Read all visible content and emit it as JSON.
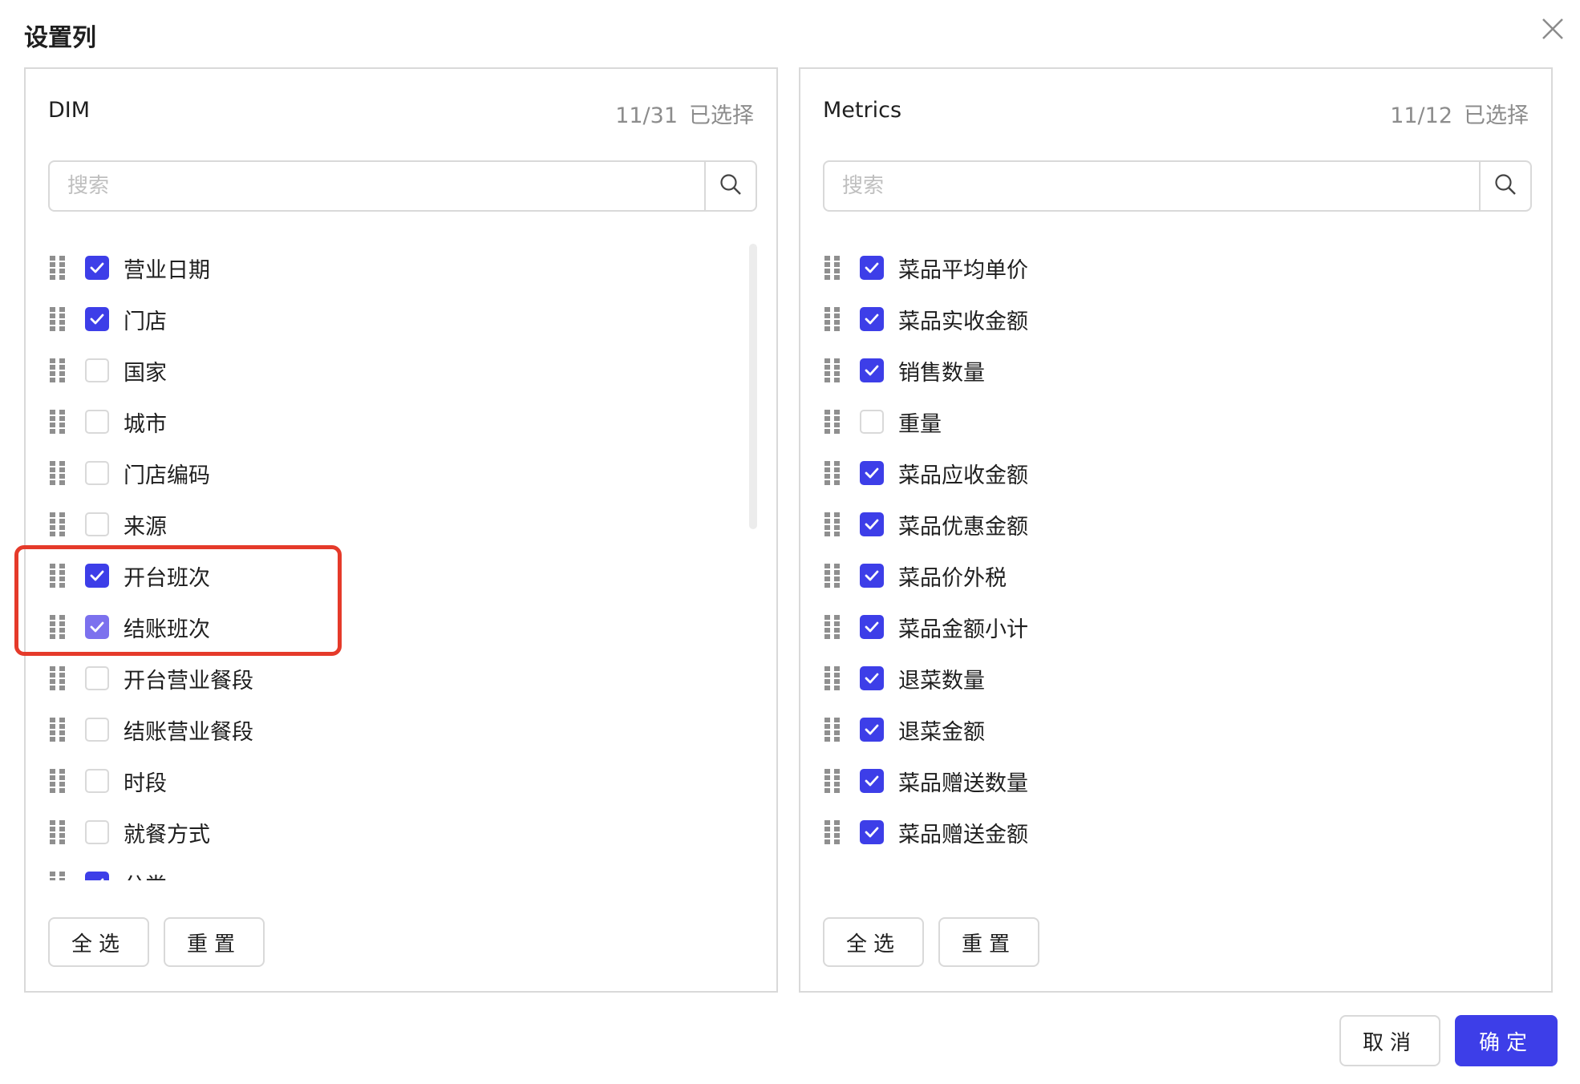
{
  "dialog": {
    "title": "设置列",
    "close_icon": "close-icon"
  },
  "colors": {
    "accent": "#3d3ee8",
    "highlight": "#e53a2a",
    "border": "#d9d9d9",
    "muted": "#8c8c8c"
  },
  "dim": {
    "title": "DIM",
    "count": "11/31",
    "selected_text": "已选择",
    "search_placeholder": "搜索",
    "items": [
      {
        "label": "营业日期",
        "checked": true
      },
      {
        "label": "门店",
        "checked": true
      },
      {
        "label": "国家",
        "checked": false
      },
      {
        "label": "城市",
        "checked": false
      },
      {
        "label": "门店编码",
        "checked": false
      },
      {
        "label": "来源",
        "checked": false
      },
      {
        "label": "开台班次",
        "checked": true
      },
      {
        "label": "结账班次",
        "checked": true
      },
      {
        "label": "开台营业餐段",
        "checked": false
      },
      {
        "label": "结账营业餐段",
        "checked": false
      },
      {
        "label": "时段",
        "checked": false
      },
      {
        "label": "就餐方式",
        "checked": false
      },
      {
        "label": "分类",
        "checked": true
      }
    ],
    "select_all_label": "全选",
    "reset_label": "重置"
  },
  "metrics": {
    "title": "Metrics",
    "count": "11/12",
    "selected_text": "已选择",
    "search_placeholder": "搜索",
    "items": [
      {
        "label": "菜品平均单价",
        "checked": true
      },
      {
        "label": "菜品实收金额",
        "checked": true
      },
      {
        "label": "销售数量",
        "checked": true
      },
      {
        "label": "重量",
        "checked": false
      },
      {
        "label": "菜品应收金额",
        "checked": true
      },
      {
        "label": "菜品优惠金额",
        "checked": true
      },
      {
        "label": "菜品价外税",
        "checked": true
      },
      {
        "label": "菜品金额小计",
        "checked": true
      },
      {
        "label": "退菜数量",
        "checked": true
      },
      {
        "label": "退菜金额",
        "checked": true
      },
      {
        "label": "菜品赠送数量",
        "checked": true
      },
      {
        "label": "菜品赠送金额",
        "checked": true
      }
    ],
    "select_all_label": "全选",
    "reset_label": "重置"
  },
  "footer": {
    "cancel_label": "取消",
    "ok_label": "确定"
  }
}
